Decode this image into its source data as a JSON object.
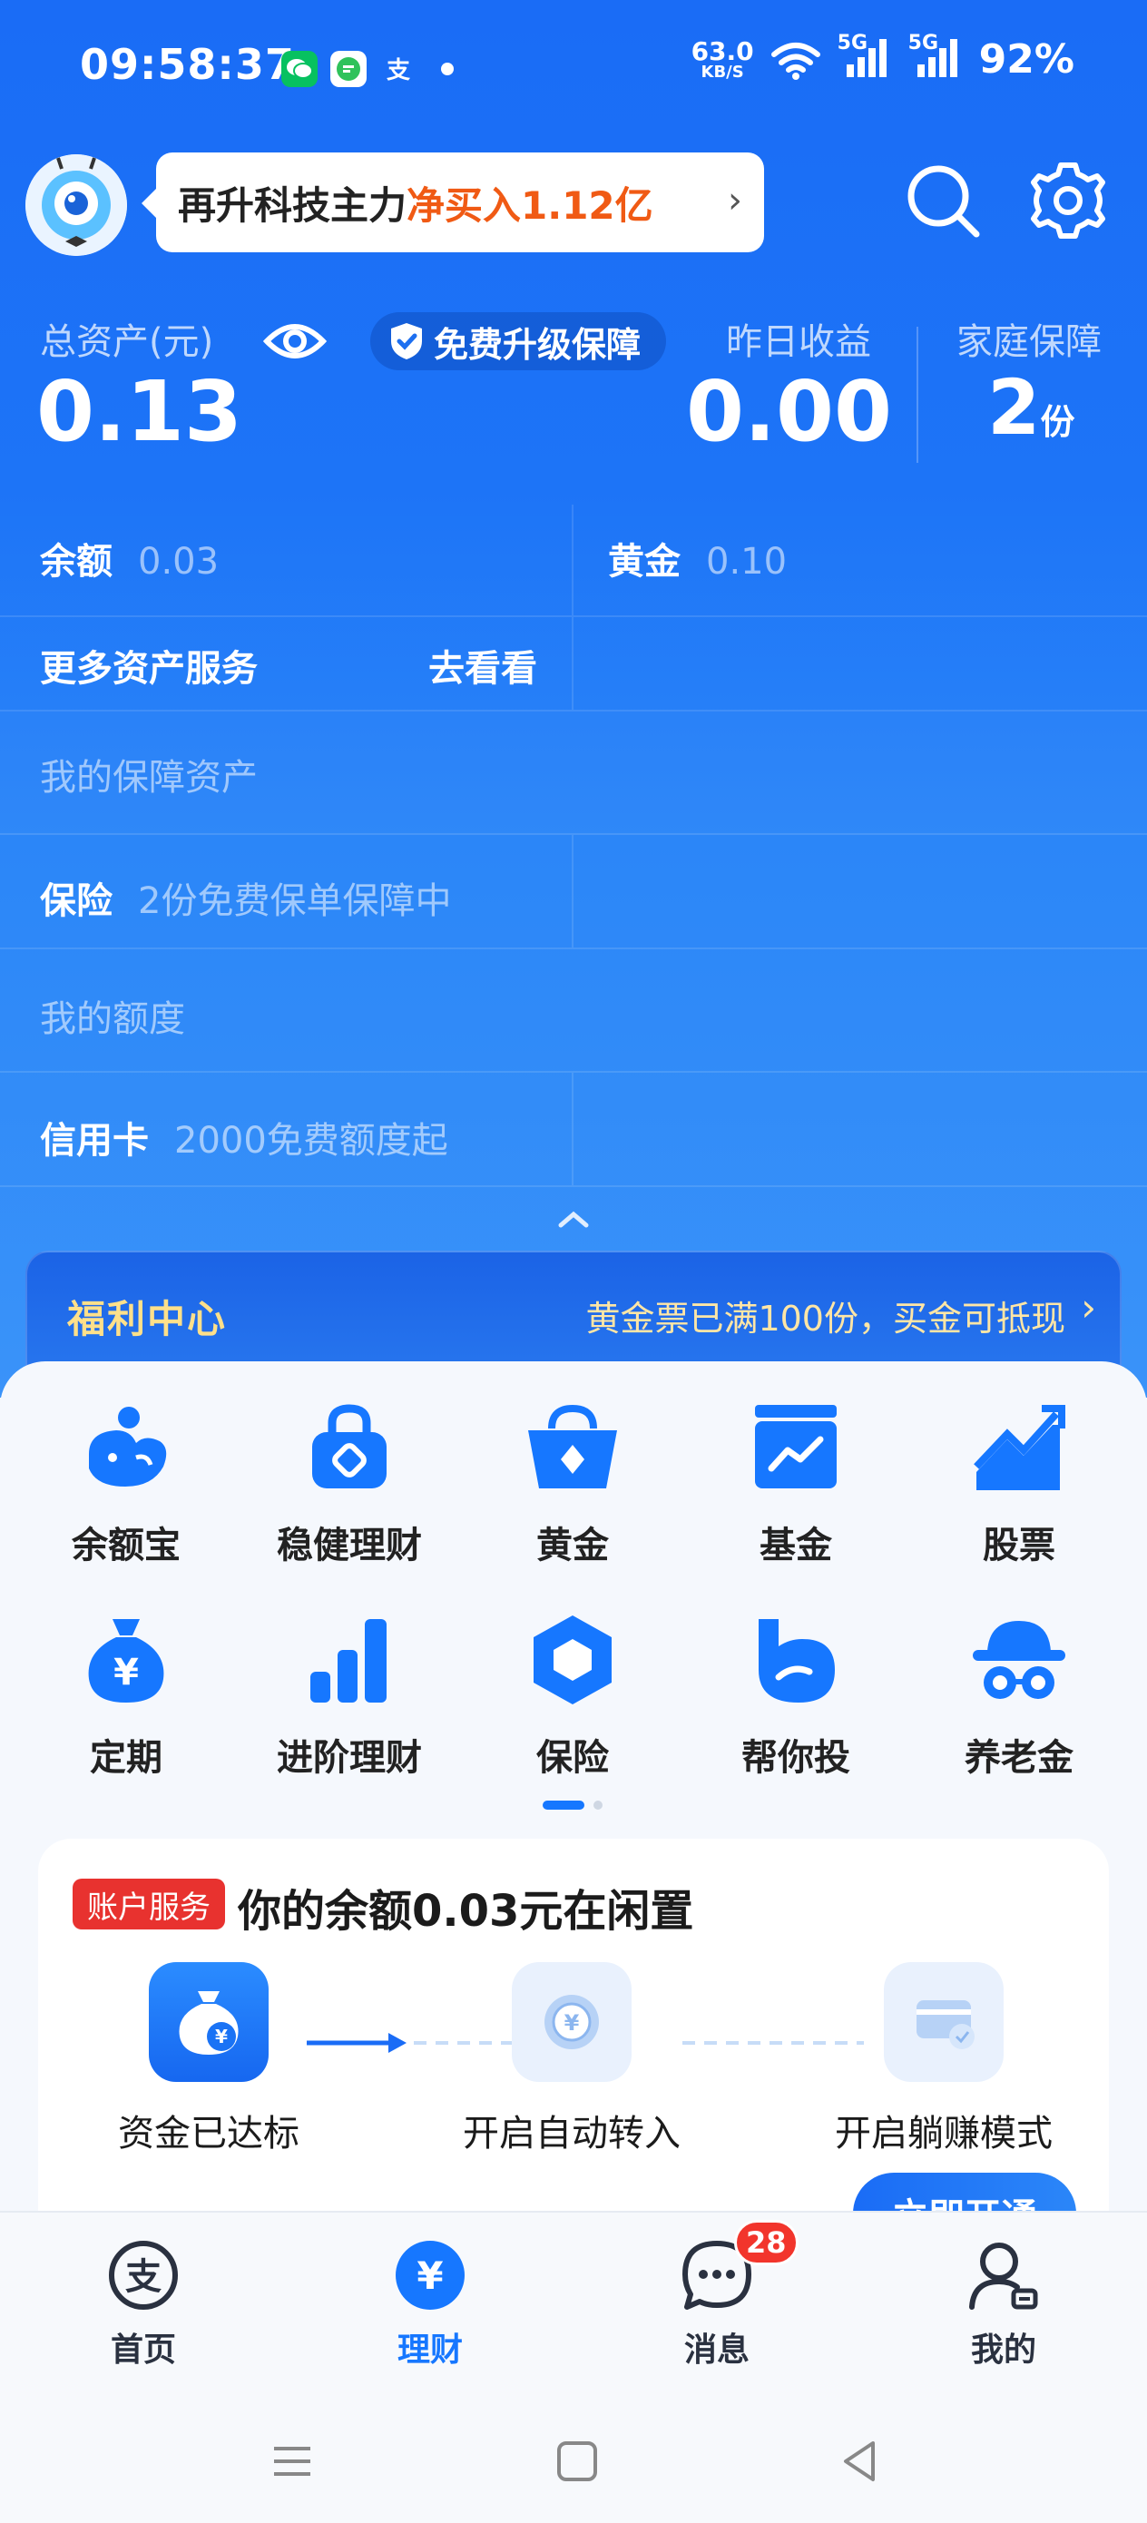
{
  "status_bar": {
    "time": "09:58:37",
    "net_speed_value": "63.0",
    "net_speed_unit": "KB/S",
    "sig1": "5G",
    "sig2": "5G",
    "battery": "92%"
  },
  "header": {
    "promo_prefix": "再升科技主力",
    "promo_highlight": "净买入1.12亿",
    "promo_arrow": "›"
  },
  "assets": {
    "total_label": "总资产(元)",
    "total_value": "0.13",
    "upgrade_badge": "免费升级保障",
    "yesterday_label": "昨日收益",
    "yesterday_value": "0.00",
    "family_label": "家庭保障",
    "family_value": "2",
    "family_unit": "份"
  },
  "rows": {
    "balance_label": "余额",
    "balance_value": "0.03",
    "gold_label": "黄金",
    "gold_value": "0.10",
    "more_services": "更多资产服务",
    "go_look": "去看看",
    "protection_assets": "我的保障资产",
    "insurance_label": "保险",
    "insurance_value": "2份免费保单保障中",
    "my_quota": "我的额度",
    "credit_label": "信用卡",
    "credit_value": "2000免费额度起"
  },
  "welfare": {
    "title": "福利中心",
    "desc": "黄金票已满100份，买金可抵现",
    "arrow": "›"
  },
  "icons": [
    {
      "label": "余额宝",
      "icon": "yuebao-icon"
    },
    {
      "label": "稳健理财",
      "icon": "lock-bag-icon"
    },
    {
      "label": "黄金",
      "icon": "gold-bag-icon"
    },
    {
      "label": "基金",
      "icon": "fund-chart-icon"
    },
    {
      "label": "股票",
      "icon": "stock-trend-icon"
    },
    {
      "label": "定期",
      "icon": "money-bag-icon"
    },
    {
      "label": "进阶理财",
      "icon": "bars-icon"
    },
    {
      "label": "保险",
      "icon": "shield-hex-icon"
    },
    {
      "label": "帮你投",
      "icon": "helper-b-icon"
    },
    {
      "label": "养老金",
      "icon": "hat-glasses-icon"
    }
  ],
  "account": {
    "tag": "账户服务",
    "title": "你的余额0.03元在闲置",
    "steps": [
      "资金已达标",
      "开启自动转入",
      "开启躺赚模式"
    ],
    "button": "立即开通"
  },
  "tabs": [
    {
      "label": "首页",
      "icon": "alipay-home-icon"
    },
    {
      "label": "理财",
      "icon": "yuan-icon"
    },
    {
      "label": "消息",
      "icon": "chat-icon",
      "badge": "28"
    },
    {
      "label": "我的",
      "icon": "user-icon"
    }
  ],
  "colors": {
    "brand_blue": "#1677ff",
    "promo_orange": "#f05a14",
    "badge_red": "#f2352c"
  }
}
